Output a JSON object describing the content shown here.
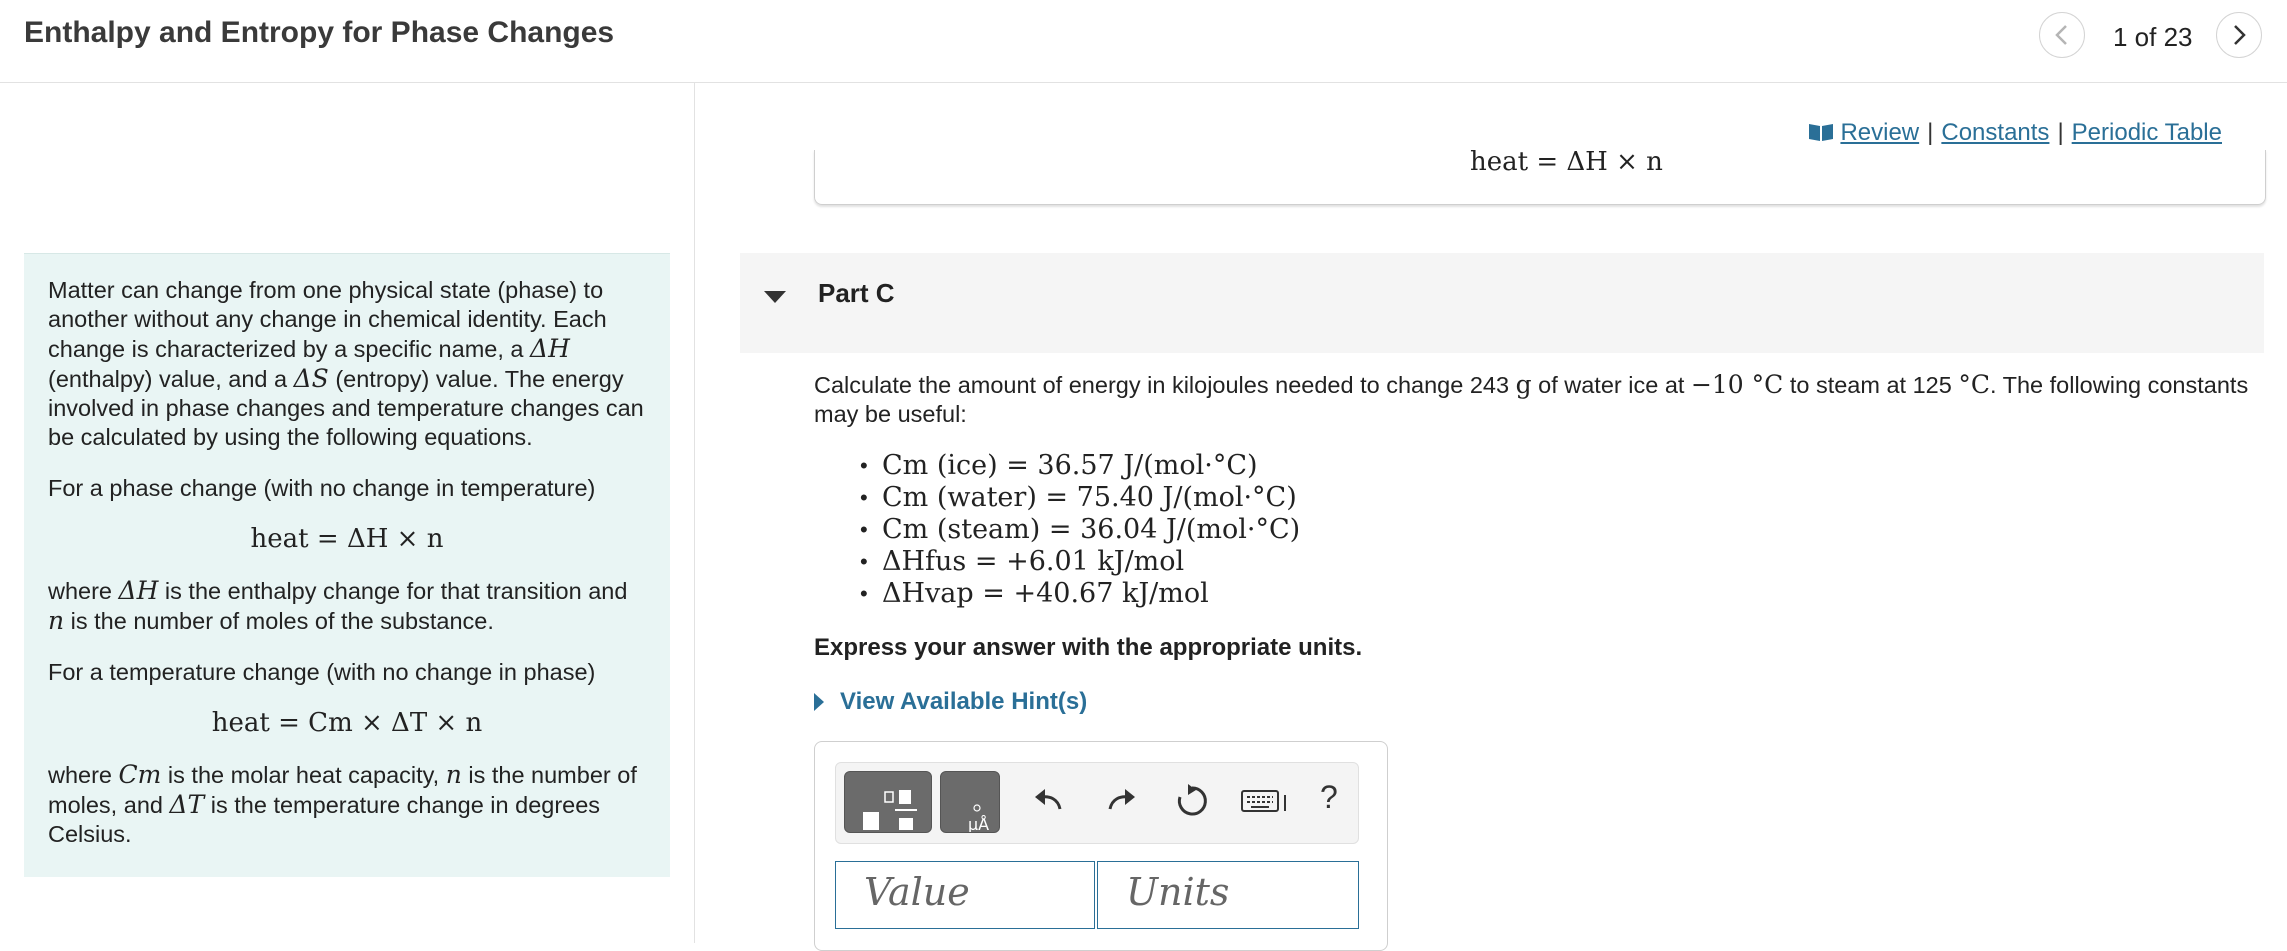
{
  "header": {
    "title": "Enthalpy and Entropy for Phase Changes",
    "page_count": "1 of 23"
  },
  "intro": {
    "p1_a": "Matter can change from one physical state (phase) to another without any change in chemical identity. Each change is characterized by a specific name, a ",
    "p1_dh": "ΔH",
    "p1_b": " (enthalpy) value, and a ",
    "p1_ds": "ΔS",
    "p1_c": " (entropy) value. The energy involved in phase changes and temperature changes can be calculated by using the following equations.",
    "p2": "For a phase change (with no change in temperature)",
    "eq1": "heat = ΔH × n",
    "p3_a": "where ",
    "p3_dh": "ΔH",
    "p3_b": " is the enthalpy change for that transition and ",
    "p3_n": "n",
    "p3_c": " is the number of moles of the substance.",
    "p4": "For a temperature change (with no change in phase)",
    "eq2": "heat = Cm × ΔT × n",
    "p5_a": "where ",
    "p5_cm": "Cm",
    "p5_b": " is the molar heat capacity, ",
    "p5_n": "n",
    "p5_c": " is the number of moles, and ",
    "p5_dt": "ΔT",
    "p5_d": " is the temperature change in degrees Celsius."
  },
  "links": {
    "review": "Review",
    "constants": "Constants",
    "periodic_table": "Periodic Table",
    "separator": "|"
  },
  "previous_part": {
    "equation": "heat = ΔH × n"
  },
  "part_c": {
    "label": "Part C",
    "question_a": "Calculate the amount of energy in kilojoules needed to change 243 ",
    "question_g": "g",
    "question_b": " of water ice at ",
    "question_t1": "−10 °C",
    "question_c": " to steam at 125 ",
    "question_t2": "°C",
    "question_d": ". The following constants may be useful:",
    "constants": [
      "Cm (ice) = 36.57 J/(mol·°C)",
      "Cm (water) = 75.40 J/(mol·°C)",
      "Cm (steam) = 36.04 J/(mol·°C)",
      "ΔHfus = +6.01 kJ/mol",
      "ΔHvap = +40.67 kJ/mol"
    ],
    "instruction": "Express your answer with the appropriate units.",
    "hints_link": "View Available Hint(s)"
  },
  "answer": {
    "value_placeholder": "Value",
    "units_placeholder": "Units",
    "help_label": "?"
  },
  "colors": {
    "link": "#2a6f97",
    "intro_bg": "#e9f5f4",
    "part_bar_bg": "#f5f5f5"
  }
}
